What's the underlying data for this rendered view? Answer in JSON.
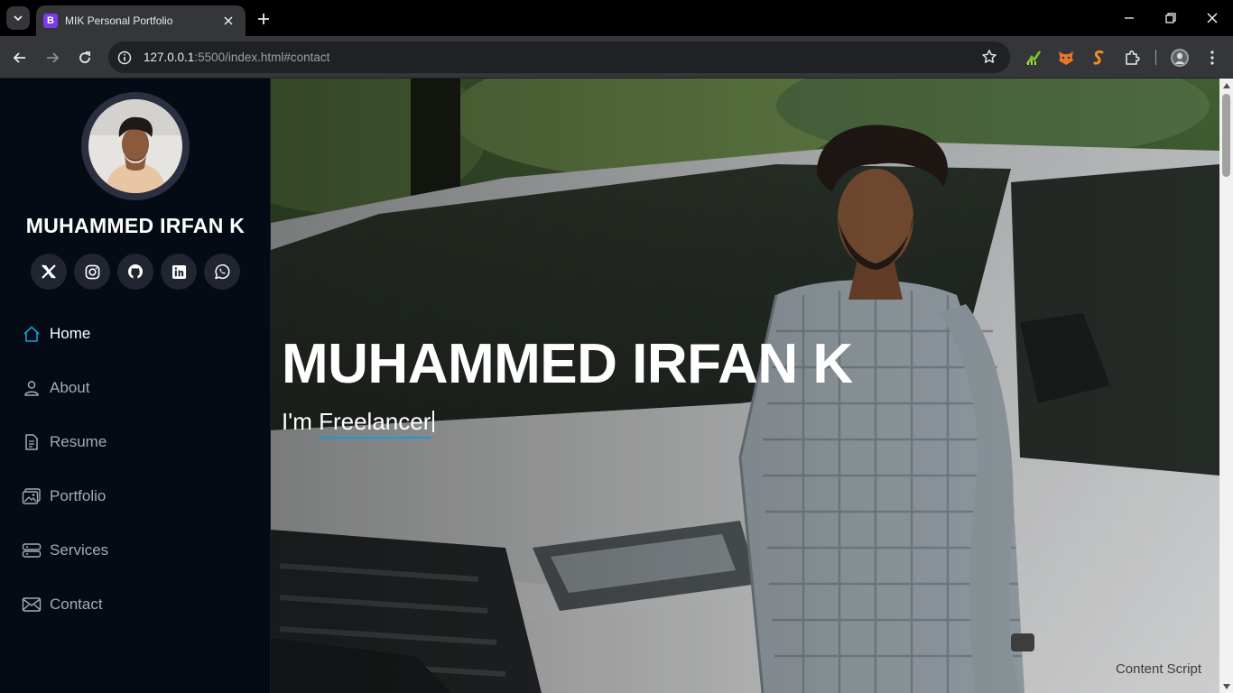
{
  "browser": {
    "tab_title": "MIK Personal Portfolio",
    "favicon_letter": "B",
    "url_host": "127.0.0.1",
    "url_rest": ":5500/index.html#contact"
  },
  "sidebar": {
    "name": "MUHAMMED IRFAN K",
    "socials": [
      "x-twitter-icon",
      "instagram-icon",
      "github-icon",
      "linkedin-icon",
      "whatsapp-icon"
    ],
    "nav": [
      {
        "label": "Home",
        "icon": "home-icon",
        "active": true
      },
      {
        "label": "About",
        "icon": "person-icon",
        "active": false
      },
      {
        "label": "Resume",
        "icon": "file-icon",
        "active": false
      },
      {
        "label": "Portfolio",
        "icon": "images-icon",
        "active": false
      },
      {
        "label": "Services",
        "icon": "server-icon",
        "active": false
      },
      {
        "label": "Contact",
        "icon": "envelope-icon",
        "active": false
      }
    ]
  },
  "hero": {
    "title": "MUHAMMED IRFAN K",
    "prefix": "I'm ",
    "typed": "Freelancer",
    "overlay_text": "Content Script"
  },
  "colors": {
    "accent": "#149ddd",
    "sidebar_bg": "#040b14",
    "social_bg": "#212431"
  }
}
